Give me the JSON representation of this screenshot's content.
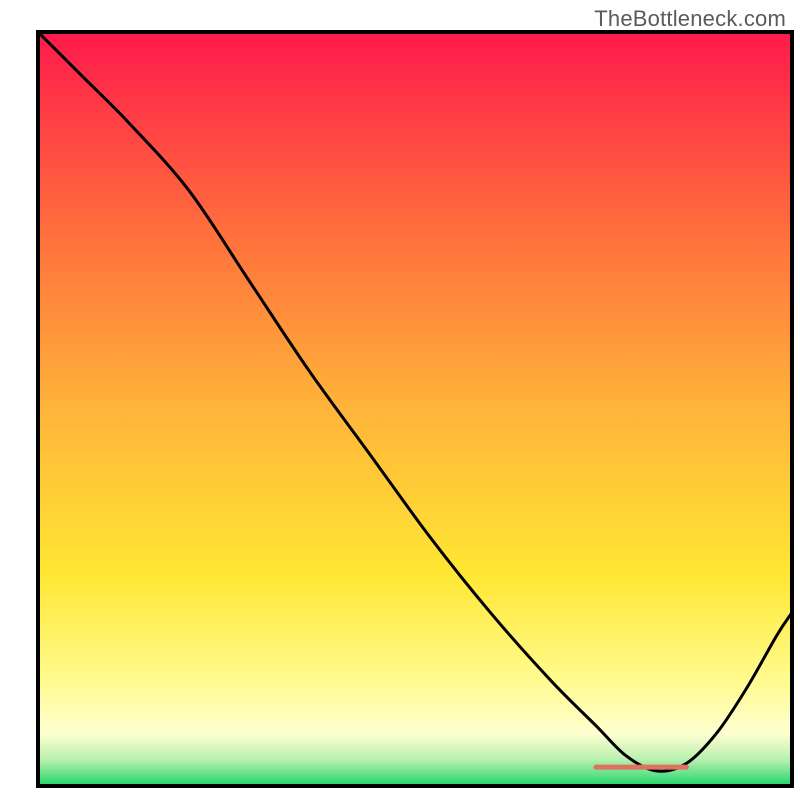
{
  "watermark": {
    "text": "TheBottleneck.com"
  },
  "chart_data": {
    "type": "line",
    "title": "",
    "xlabel": "",
    "ylabel": "",
    "xlim": [
      0,
      100
    ],
    "ylim": [
      0,
      100
    ],
    "grid": false,
    "legend": false,
    "background_gradient": {
      "type": "linear-vertical",
      "stops": [
        {
          "offset": 0.0,
          "color": "#ff1a4b"
        },
        {
          "offset": 0.25,
          "color": "#ff6a3d"
        },
        {
          "offset": 0.5,
          "color": "#ffb43a"
        },
        {
          "offset": 0.72,
          "color": "#ffe733"
        },
        {
          "offset": 0.86,
          "color": "#fffb8f"
        },
        {
          "offset": 0.93,
          "color": "#ffffd0"
        },
        {
          "offset": 0.965,
          "color": "#b8f0b0"
        },
        {
          "offset": 1.0,
          "color": "#1fd66a"
        }
      ]
    },
    "curve": {
      "description": "Black curve, starts top-left, descends to a minimum near x≈82, rises toward right edge.",
      "x": [
        0,
        6,
        12,
        20,
        28,
        36,
        44,
        52,
        60,
        68,
        74,
        78,
        82,
        86,
        90,
        94,
        98,
        100
      ],
      "y_pct": [
        100,
        94,
        88,
        79,
        67,
        55,
        44,
        33,
        23,
        14,
        8,
        4,
        2,
        3,
        7,
        13,
        20,
        23
      ]
    },
    "marker_bar": {
      "description": "Short red tick segment at the curve minimum",
      "x_start_pct": 74,
      "x_end_pct": 86,
      "y_pct": 2.5,
      "color": "#e0715e",
      "thickness_px": 5
    }
  }
}
